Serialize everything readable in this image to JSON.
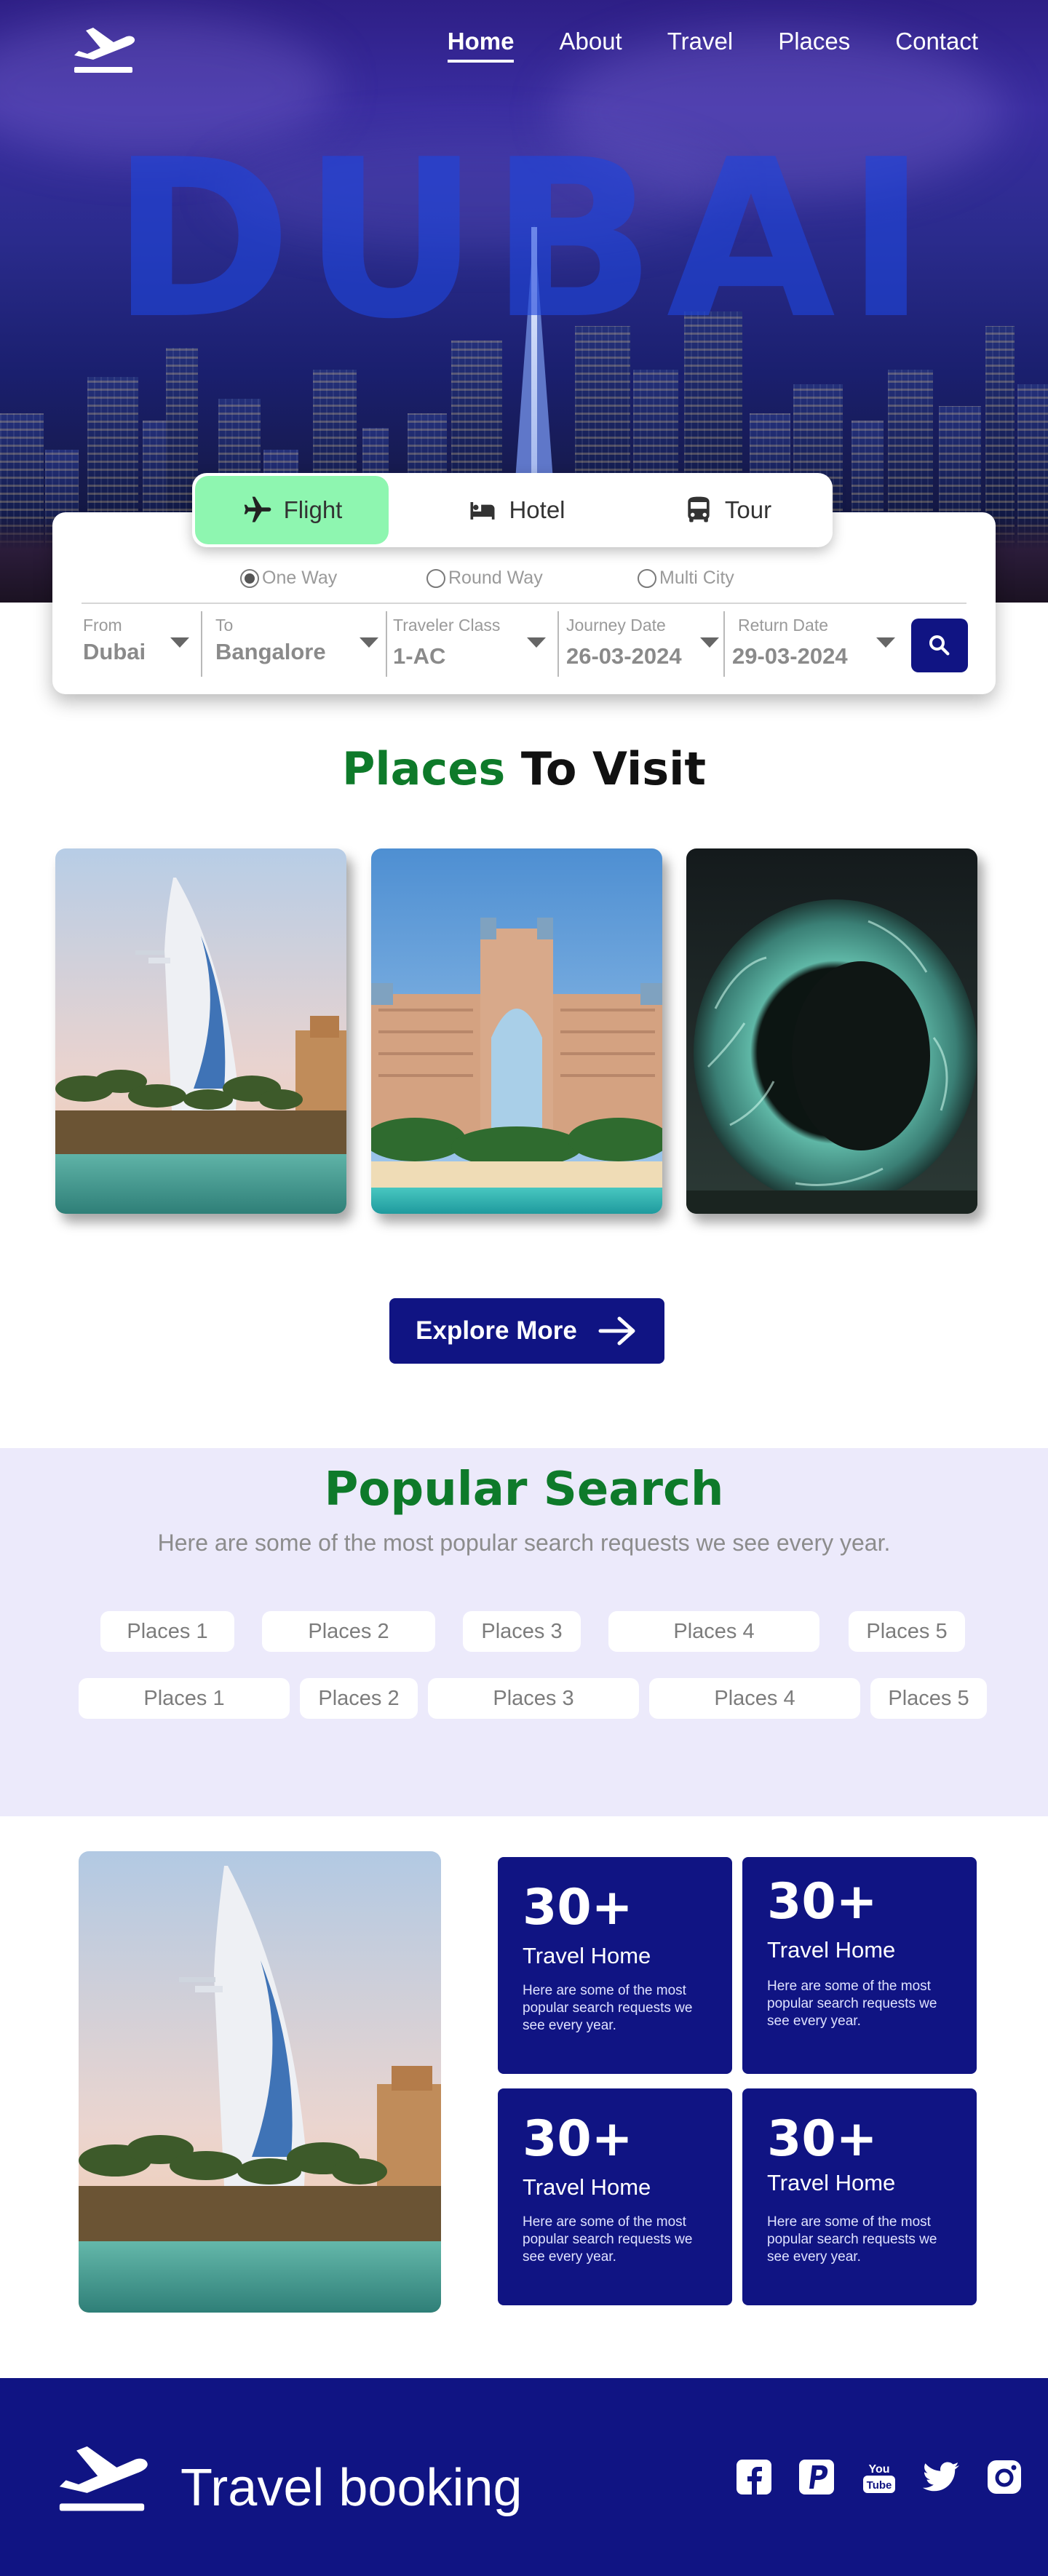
{
  "nav": {
    "items": [
      {
        "label": "Home",
        "active": true
      },
      {
        "label": "About",
        "active": false
      },
      {
        "label": "Travel",
        "active": false
      },
      {
        "label": "Places",
        "active": false
      },
      {
        "label": "Contact",
        "active": false
      }
    ],
    "logo_icon": "airplane-departure-icon"
  },
  "hero": {
    "title": "DUBAI"
  },
  "booking": {
    "tabs": [
      {
        "label": "Flight",
        "icon": "airplane-icon",
        "active": true
      },
      {
        "label": "Hotel",
        "icon": "bed-icon",
        "active": false
      },
      {
        "label": "Tour",
        "icon": "bus-icon",
        "active": false
      }
    ],
    "trip_types": [
      {
        "label": "One Way",
        "selected": true
      },
      {
        "label": "Round Way",
        "selected": false
      },
      {
        "label": "Multi City",
        "selected": false
      }
    ],
    "fields": [
      {
        "label": "From",
        "value": "Dubai"
      },
      {
        "label": "To",
        "value": "Bangalore"
      },
      {
        "label": "Traveler Class",
        "value": "1-AC"
      },
      {
        "label": "Journey Date",
        "value": "26-03-2024"
      },
      {
        "label": "Return Date",
        "value": "29-03-2024"
      }
    ],
    "search_icon": "search-icon"
  },
  "places": {
    "title_highlight": "Places",
    "title_rest": " To Visit",
    "explore_label": "Explore More"
  },
  "popular": {
    "title": "Popular Search",
    "subtitle": "Here are some of the most popular search requests we see every year.",
    "row1": [
      "Places 1",
      "Places 2",
      "Places 3",
      "Places 4",
      "Places 5"
    ],
    "row2": [
      "Places 1",
      "Places 2",
      "Places 3",
      "Places 4",
      "Places 5"
    ]
  },
  "stats": [
    {
      "number": "30+",
      "title": "Travel Home",
      "desc": "Here are some of the most popular search requests we see every year."
    },
    {
      "number": "30+",
      "title": "Travel Home",
      "desc": "Here are some of the most popular search requests we see every year."
    },
    {
      "number": "30+",
      "title": "Travel Home",
      "desc": "Here are some of the most popular search requests we see every year."
    },
    {
      "number": "30+",
      "title": "Travel Home",
      "desc": "Here are some of the most popular search requests we see every year."
    }
  ],
  "footer": {
    "brand": "Travel booking",
    "social": [
      "facebook-icon",
      "paypal-icon",
      "youtube-icon",
      "twitter-icon",
      "instagram-icon"
    ]
  },
  "colors": {
    "primary": "#101483",
    "accent_green": "#0e7a2a",
    "tab_active": "#8ef6b0",
    "popular_bg": "#eceafb"
  }
}
